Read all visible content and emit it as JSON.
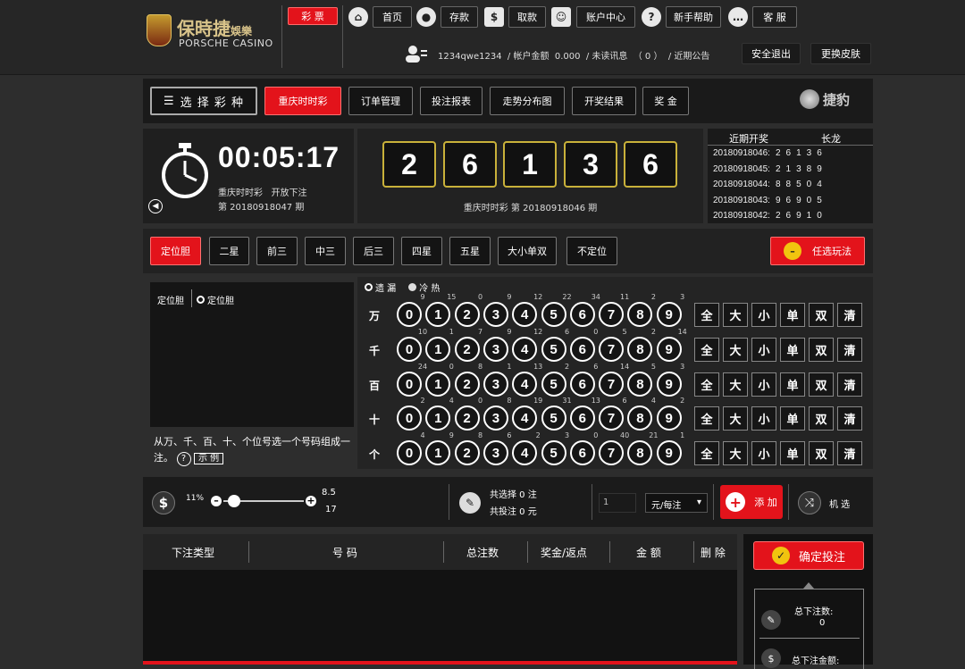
{
  "header": {
    "brand_cn": "保時捷",
    "brand_cn_small": "娛樂",
    "brand_en": "PORSCHE CASINO",
    "lottery_tab": "彩 票",
    "nav": [
      {
        "label": "首页",
        "icon": "home-icon"
      },
      {
        "label": "存款",
        "icon": "piggy-bank-icon"
      },
      {
        "label": "取款",
        "icon": "cash-icon"
      },
      {
        "label": "账户中心",
        "icon": "id-card-icon"
      },
      {
        "label": "新手帮助",
        "icon": "help-icon"
      },
      {
        "label": "客 服",
        "icon": "chat-icon"
      }
    ],
    "user": {
      "username": "1234qwe1234",
      "balance_label": "帐户金额",
      "balance": "0.000",
      "unread_label": "未读讯息",
      "unread": "（ 0 ）",
      "notice": "近期公告"
    },
    "logout": "安全退出",
    "skin": "更换皮肤"
  },
  "toolbar": {
    "select_game": "选 择 彩 种",
    "tabs": [
      "重庆时时彩",
      "订单管理",
      "投注报表",
      "走势分布图",
      "开奖结果",
      "奖 金"
    ],
    "partner_logo": "捷豹"
  },
  "timer": {
    "countdown": "00:05:17",
    "game": "重庆时时彩",
    "status": "开放下注",
    "period": "第 20180918047 期"
  },
  "draw": {
    "digits": [
      "2",
      "6",
      "1",
      "3",
      "6"
    ],
    "caption": "重庆时时彩 第 20180918046 期"
  },
  "history": {
    "headers": [
      "近期开奖",
      "长龙"
    ],
    "rows": [
      {
        "period": "20180918046:",
        "nums": [
          "2",
          "6",
          "1",
          "3",
          "6"
        ]
      },
      {
        "period": "20180918045:",
        "nums": [
          "2",
          "1",
          "3",
          "8",
          "9"
        ]
      },
      {
        "period": "20180918044:",
        "nums": [
          "8",
          "8",
          "5",
          "0",
          "4"
        ]
      },
      {
        "period": "20180918043:",
        "nums": [
          "9",
          "6",
          "9",
          "0",
          "5"
        ]
      },
      {
        "period": "20180918042:",
        "nums": [
          "2",
          "6",
          "9",
          "1",
          "0"
        ]
      }
    ]
  },
  "play_tabs": [
    "定位胆",
    "二星",
    "前三",
    "中三",
    "后三",
    "四星",
    "五星",
    "大小单双",
    "不定位"
  ],
  "free_choose": "任选玩法",
  "method": {
    "name": "定位胆",
    "option": "定位胆",
    "desc": "从万、千、百、十、个位号选一个号码组成一注。",
    "example": "示 例"
  },
  "stats_toggle": {
    "miss": "遗 漏",
    "hot": "冷 热"
  },
  "positions": [
    {
      "label": "万",
      "miss": [
        "9",
        "15",
        "0",
        "9",
        "12",
        "22",
        "34",
        "11",
        "2",
        "3"
      ]
    },
    {
      "label": "千",
      "miss": [
        "10",
        "1",
        "7",
        "9",
        "12",
        "6",
        "0",
        "5",
        "2",
        "14"
      ]
    },
    {
      "label": "百",
      "miss": [
        "24",
        "0",
        "8",
        "1",
        "13",
        "2",
        "6",
        "14",
        "5",
        "3"
      ]
    },
    {
      "label": "十",
      "miss": [
        "2",
        "4",
        "0",
        "8",
        "19",
        "31",
        "13",
        "6",
        "4",
        "2"
      ]
    },
    {
      "label": "个",
      "miss": [
        "4",
        "9",
        "8",
        "6",
        "2",
        "3",
        "0",
        "40",
        "21",
        "1"
      ]
    }
  ],
  "balls": [
    "0",
    "1",
    "2",
    "3",
    "4",
    "5",
    "6",
    "7",
    "8",
    "9"
  ],
  "quick": [
    "全",
    "大",
    "小",
    "单",
    "双",
    "清"
  ],
  "rebate": {
    "percent": "11%",
    "odds_top": "8.5",
    "odds_bottom": "17",
    "slider_level": 0.05
  },
  "summary": {
    "selected": "共选择 0 注",
    "total": "共投注 0 元"
  },
  "bet": {
    "multiplier": "1",
    "unit": "元/每注",
    "add": "添 加",
    "random": "机 选"
  },
  "table_headers": [
    "下注类型",
    "号 码",
    "总注数",
    "奖金/返点",
    "金 额",
    "删 除"
  ],
  "confirm": "确定投注",
  "totals": {
    "count_label": "总下注数:",
    "count": "0",
    "amount_label": "总下注金额:"
  }
}
